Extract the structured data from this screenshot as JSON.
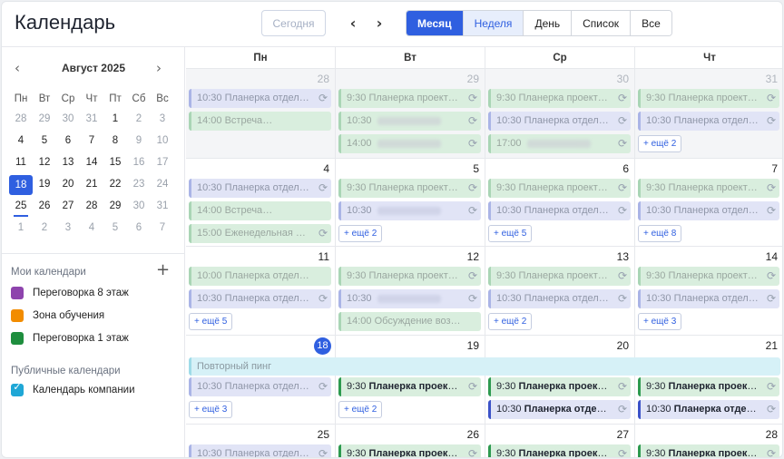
{
  "app_title": "Календарь",
  "toolbar": {
    "today": "Сегодня",
    "prev": "‹",
    "next": "›",
    "views": [
      "Месяц",
      "Неделя",
      "День",
      "Список",
      "Все"
    ]
  },
  "mini_calendar": {
    "month_label": "Август 2025",
    "prev": "‹",
    "next": "›",
    "dow": [
      "Пн",
      "Вт",
      "Ср",
      "Чт",
      "Пт",
      "Сб",
      "Вс"
    ],
    "weeks": [
      [
        "28",
        "29",
        "30",
        "31",
        "1",
        "2",
        "3"
      ],
      [
        "4",
        "5",
        "6",
        "7",
        "8",
        "9",
        "10"
      ],
      [
        "11",
        "12",
        "13",
        "14",
        "15",
        "16",
        "17"
      ],
      [
        "18",
        "19",
        "20",
        "21",
        "22",
        "23",
        "24"
      ],
      [
        "25",
        "26",
        "27",
        "28",
        "29",
        "30",
        "31"
      ],
      [
        "1",
        "2",
        "3",
        "4",
        "5",
        "6",
        "7"
      ]
    ]
  },
  "my_calendars": {
    "title": "Мои календари",
    "add": "+",
    "items": [
      {
        "label": "Переговорка 8 этаж",
        "color": "#8e44ad"
      },
      {
        "label": "Зона обучения",
        "color": "#f28c00"
      },
      {
        "label": "Переговорка 1 этаж",
        "color": "#1e8e3e"
      }
    ]
  },
  "public_calendars": {
    "title": "Публичные календари",
    "items": [
      {
        "label": "Календарь компании",
        "color": "#1fa7d6"
      }
    ]
  },
  "grid": {
    "dow": [
      "Пн",
      "Вт",
      "Ср",
      "Чт"
    ],
    "weeks": [
      {
        "days": [
          {
            "num": "28",
            "events": [
              {
                "text": "10:30 Планерка отдела ...",
                "c": "purple",
                "r": true
              },
              {
                "text": "14:00 Встреча",
                "c": "green",
                "blur": true
              }
            ]
          },
          {
            "num": "29",
            "events": [
              {
                "text": "9:30 Планерка проектн...",
                "c": "green",
                "r": true
              },
              {
                "text": "10:30",
                "c": "green",
                "blur": true,
                "r": true
              },
              {
                "text": "14:00",
                "c": "green",
                "blur": true,
                "r": true
              }
            ]
          },
          {
            "num": "30",
            "events": [
              {
                "text": "9:30 Планерка проектн...",
                "c": "green",
                "r": true
              },
              {
                "text": "10:30 Планерка отдела ...",
                "c": "purple",
                "r": true
              },
              {
                "text": "17:00",
                "c": "green",
                "blur": true,
                "r": true
              }
            ]
          },
          {
            "num": "31",
            "events": [
              {
                "text": "9:30 Планерка проектн...",
                "c": "green",
                "r": true
              },
              {
                "text": "10:30 Планерка отдела ...",
                "c": "purple",
                "r": true
              }
            ],
            "more": "+ ещё 2"
          }
        ]
      },
      {
        "days": [
          {
            "num": "4",
            "events": [
              {
                "text": "10:30 Планерка отдела ...",
                "c": "purple",
                "r": true
              },
              {
                "text": "14:00 Встреча",
                "c": "green",
                "blur": true
              },
              {
                "text": "15:00 Еженедельная ин...",
                "c": "green",
                "r": true
              }
            ]
          },
          {
            "num": "5",
            "events": [
              {
                "text": "9:30 Планерка проектн...",
                "c": "green",
                "r": true
              },
              {
                "text": "10:30",
                "c": "purple",
                "blur": true,
                "r": true
              }
            ],
            "more": "+ ещё 2"
          },
          {
            "num": "6",
            "events": [
              {
                "text": "9:30 Планерка проектн...",
                "c": "green",
                "r": true
              },
              {
                "text": "10:30 Планерка отдела ...",
                "c": "purple",
                "r": true
              }
            ],
            "more": "+ ещё 5"
          },
          {
            "num": "7",
            "events": [
              {
                "text": "9:30 Планерка проектн...",
                "c": "green",
                "r": true
              },
              {
                "text": "10:30 Планерка отдела ...",
                "c": "purple",
                "r": true
              }
            ],
            "more": "+ ещё 8"
          }
        ]
      },
      {
        "days": [
          {
            "num": "11",
            "events": [
              {
                "text": "10:00 Планерка отдела ма...",
                "c": "green"
              },
              {
                "text": "10:30 Планерка отдела ...",
                "c": "purple",
                "r": true
              }
            ],
            "more": "+ ещё 5"
          },
          {
            "num": "12",
            "events": [
              {
                "text": "9:30 Планерка проектн...",
                "c": "green",
                "r": true
              },
              {
                "text": "10:30",
                "c": "purple",
                "blur": true,
                "r": true
              },
              {
                "text": "14:00 Обсуждение возмож...",
                "c": "green"
              }
            ]
          },
          {
            "num": "13",
            "events": [
              {
                "text": "9:30 Планерка проектн...",
                "c": "green",
                "r": true
              },
              {
                "text": "10:30 Планерка отдела ...",
                "c": "purple",
                "r": true
              }
            ],
            "more": "+ ещё 2"
          },
          {
            "num": "14",
            "events": [
              {
                "text": "9:30 Планерка проектн...",
                "c": "green",
                "r": true
              },
              {
                "text": "10:30 Планерка отдела ...",
                "c": "purple",
                "r": true
              }
            ],
            "more": "+ ещё 3"
          }
        ]
      },
      {
        "band": "Повторный пинг",
        "days": [
          {
            "num": "18",
            "today": true,
            "events": [
              {
                "text": "10:30 Планерка отдела ...",
                "c": "purple",
                "r": true
              }
            ],
            "more": "+ ещё 3"
          },
          {
            "num": "19",
            "events": [
              {
                "time": "9:30",
                "title": "Планерка проектн...",
                "c": "green",
                "strong": true,
                "r": true
              }
            ],
            "more": "+ ещё 2"
          },
          {
            "num": "20",
            "events": [
              {
                "time": "9:30",
                "title": "Планерка проектн...",
                "c": "green",
                "strong": true,
                "r": true
              },
              {
                "time": "10:30",
                "title": "Планерка отдела ...",
                "c": "purple",
                "strong": true,
                "r": true
              }
            ]
          },
          {
            "num": "21",
            "events": [
              {
                "time": "9:30",
                "title": "Планерка проектн...",
                "c": "green",
                "strong": true,
                "r": true
              },
              {
                "time": "10:30",
                "title": "Планерка отдела ...",
                "c": "purple",
                "strong": true,
                "r": true
              }
            ]
          }
        ]
      },
      {
        "days": [
          {
            "num": "25",
            "events": [
              {
                "text": "10:30 Планерка отдела ...",
                "c": "purple",
                "r": true
              }
            ]
          },
          {
            "num": "26",
            "events": [
              {
                "time": "9:30",
                "title": "Планерка проектн...",
                "c": "green",
                "strong": true,
                "r": true
              }
            ]
          },
          {
            "num": "27",
            "events": [
              {
                "time": "9:30",
                "title": "Планерка проектн...",
                "c": "green",
                "strong": true,
                "r": true
              }
            ]
          },
          {
            "num": "28",
            "events": [
              {
                "time": "9:30",
                "title": "Планерка проектн...",
                "c": "green",
                "strong": true,
                "r": true
              }
            ]
          }
        ]
      }
    ]
  }
}
